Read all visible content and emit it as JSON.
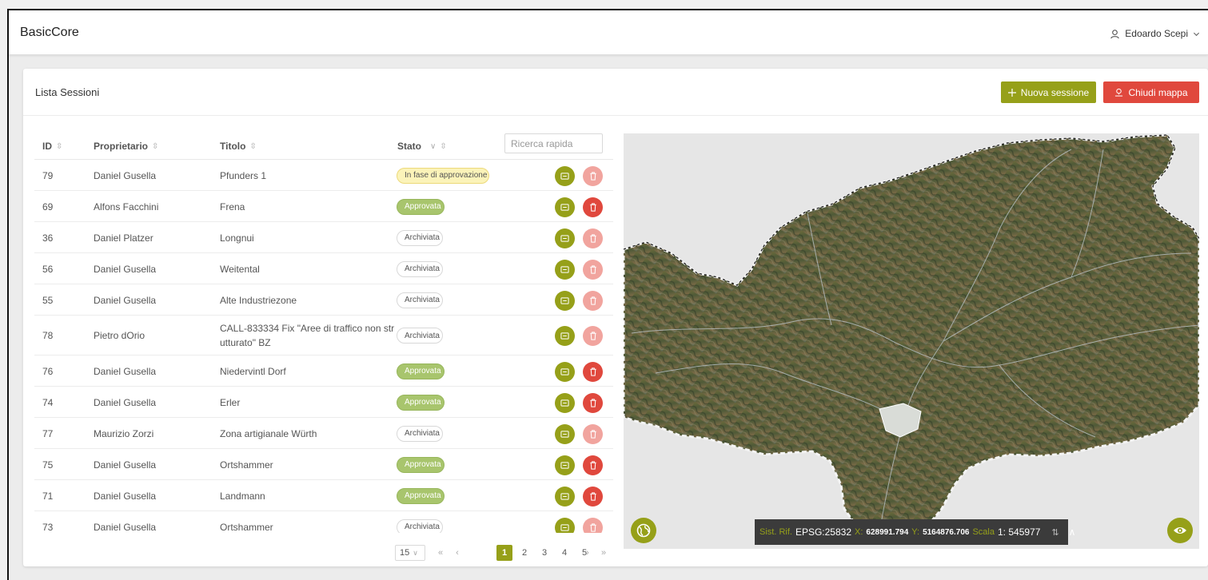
{
  "app": {
    "title": "BasicCore"
  },
  "user": {
    "name": "Edoardo Scepi"
  },
  "panel": {
    "title": "Lista Sessioni",
    "new_session": "Nuova sessione",
    "close_map": "Chiudi mappa"
  },
  "table": {
    "headers": {
      "id": "ID",
      "owner": "Proprietario",
      "title": "Titolo",
      "state": "Stato"
    },
    "search_placeholder": "Ricerca rapida",
    "rows": [
      {
        "id": "79",
        "owner": "Daniel Gusella",
        "title": "Pfunders 1",
        "state": "In fase di approvazione",
        "kind": "pending",
        "delete_enabled": false
      },
      {
        "id": "69",
        "owner": "Alfons Facchini",
        "title": "Frena",
        "state": "Approvata",
        "kind": "approved",
        "delete_enabled": true
      },
      {
        "id": "36",
        "owner": "Daniel Platzer",
        "title": "Longnui",
        "state": "Archiviata",
        "kind": "archived",
        "delete_enabled": false
      },
      {
        "id": "56",
        "owner": "Daniel Gusella",
        "title": "Weitental",
        "state": "Archiviata",
        "kind": "archived",
        "delete_enabled": false
      },
      {
        "id": "55",
        "owner": "Daniel Gusella",
        "title": "Alte Industriezone",
        "state": "Archiviata",
        "kind": "archived",
        "delete_enabled": false
      },
      {
        "id": "78",
        "owner": "Pietro dOrio",
        "title": "CALL-833334 Fix \"Aree di traffico non str",
        "title2": "utturato\" BZ",
        "state": "Archiviata",
        "kind": "archived",
        "delete_enabled": false
      },
      {
        "id": "76",
        "owner": "Daniel Gusella",
        "title": "Niedervintl Dorf",
        "state": "Approvata",
        "kind": "approved",
        "delete_enabled": true
      },
      {
        "id": "74",
        "owner": "Daniel Gusella",
        "title": "Erler",
        "state": "Approvata",
        "kind": "approved",
        "delete_enabled": true
      },
      {
        "id": "77",
        "owner": "Maurizio Zorzi",
        "title": "Zona artigianale Würth",
        "state": "Archiviata",
        "kind": "archived",
        "delete_enabled": false
      },
      {
        "id": "75",
        "owner": "Daniel Gusella",
        "title": "Ortshammer",
        "state": "Approvata",
        "kind": "approved",
        "delete_enabled": true
      },
      {
        "id": "71",
        "owner": "Daniel Gusella",
        "title": "Landmann",
        "state": "Approvata",
        "kind": "approved",
        "delete_enabled": true
      },
      {
        "id": "73",
        "owner": "Daniel Gusella",
        "title": "Ortshammer",
        "state": "Archiviata",
        "kind": "archived",
        "delete_enabled": false
      }
    ]
  },
  "pagination": {
    "page_size": "15",
    "pages": [
      "1",
      "2",
      "3",
      "4",
      "5"
    ],
    "current": "1"
  },
  "map": {
    "crs_label": "Sist. Rif.",
    "crs_value": "EPSG:25832",
    "x_label": "X:",
    "x_value": "628991.794",
    "y_label": "Y:",
    "y_value": "5164876.706",
    "scale_label": "Scala",
    "scale_value": "1: 545977"
  },
  "colors": {
    "accent": "#96a019",
    "danger": "#e0483d",
    "danger_disabled": "#f1a49e"
  }
}
